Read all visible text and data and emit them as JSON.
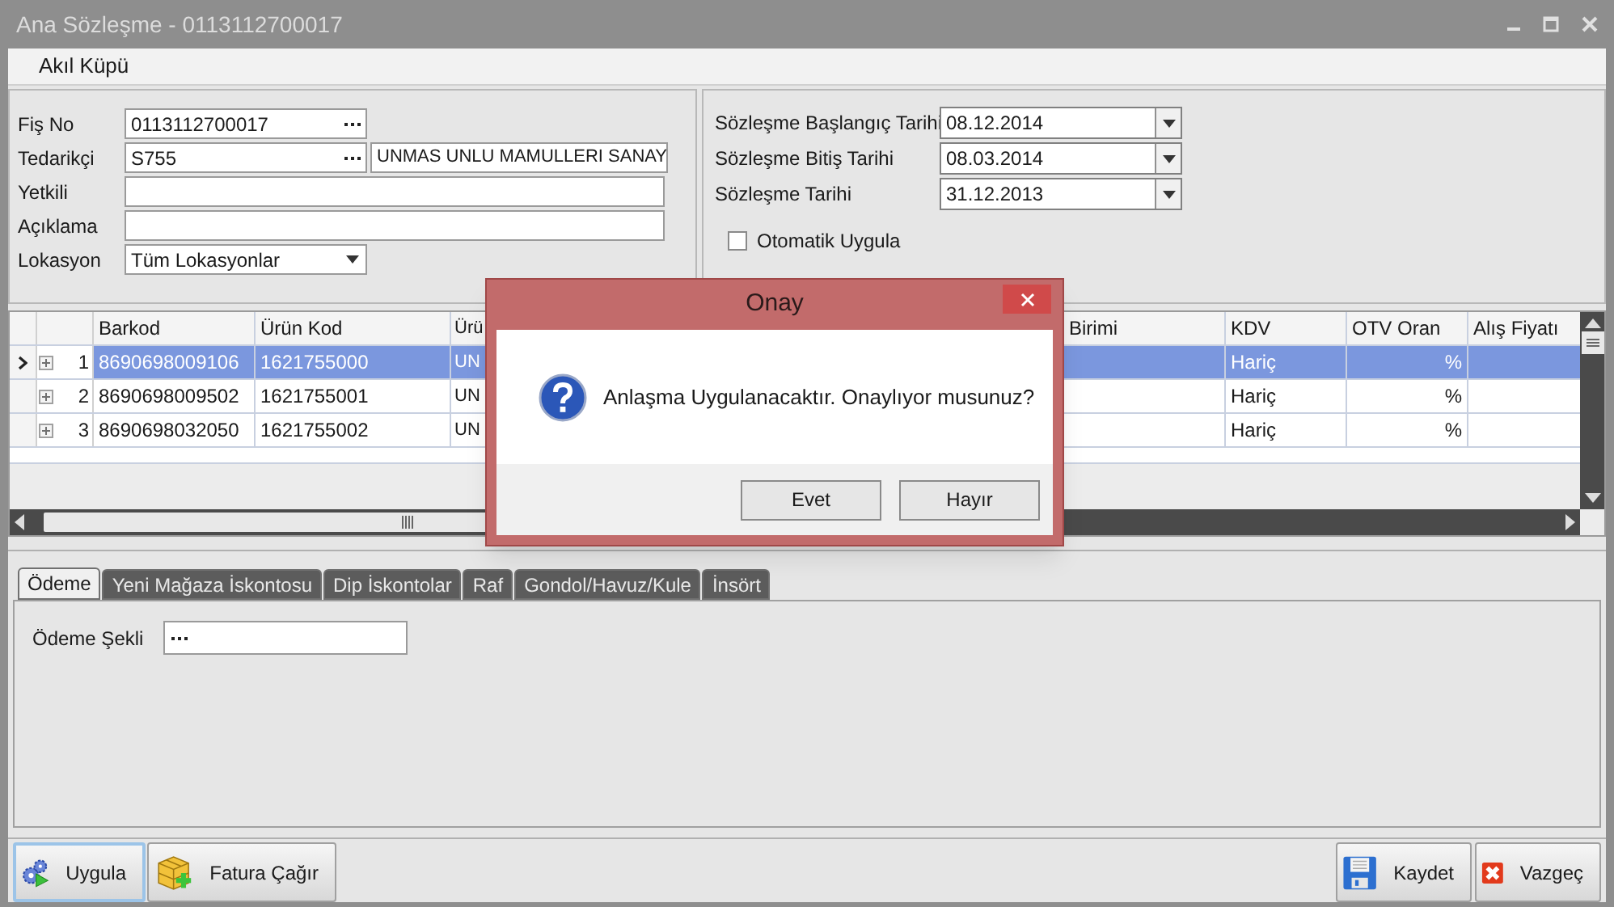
{
  "window": {
    "title": "Ana Sözleşme - 0113112700017"
  },
  "menu": [
    {
      "label": "Akıl Küpü"
    }
  ],
  "header_left": {
    "fields": [
      {
        "kind": "lookup",
        "label": "Fiş No",
        "value": "0113112700017"
      },
      {
        "kind": "lookup_pair",
        "label": "Tedarikçi",
        "value": "S755",
        "value_2": "UNMAS UNLU MAMULLERI SANAY"
      },
      {
        "kind": "text",
        "label": "Yetkili"
      },
      {
        "kind": "text",
        "label": "Açıklama"
      },
      {
        "kind": "dropdown",
        "label": "Lokasyon",
        "value": "Tüm Lokasyonlar"
      }
    ]
  },
  "header_right": {
    "fields": [
      {
        "label": "Sözleşme Başlangıç Tarihi",
        "value": "08.12.2014"
      },
      {
        "label": "Sözleşme Bitiş Tarihi",
        "value": "08.03.2014"
      },
      {
        "label": "Sözleşme Tarihi",
        "value": "31.12.2013"
      }
    ],
    "checkbox": {
      "label": "Otomatik Uygula",
      "checked": false
    }
  },
  "grid": {
    "columns": [
      "Barkod",
      "Ürün Kod",
      "Ürü",
      "Birimi",
      "KDV",
      "OTV Oran",
      "Alış Fiyatı"
    ],
    "rows": [
      {
        "number": "1",
        "selected": true,
        "cells": [
          "8690698009106",
          "1621755000",
          "UN",
          null,
          "Hariç",
          "%",
          null
        ]
      },
      {
        "number": "2",
        "selected": false,
        "cells": [
          "8690698009502",
          "1621755001",
          "UN",
          null,
          "Hariç",
          "%",
          null
        ]
      },
      {
        "number": "3",
        "selected": false,
        "cells": [
          "8690698032050",
          "1621755002",
          "UN",
          null,
          "Hariç",
          "%",
          null
        ]
      }
    ]
  },
  "tabs": [
    {
      "label": "Ödeme",
      "selected": true
    },
    {
      "label": "Yeni Mağaza İskontosu",
      "selected": false
    },
    {
      "label": "Dip İskontolar",
      "selected": false
    },
    {
      "label": "Raf",
      "selected": false
    },
    {
      "label": "Gondol/Havuz/Kule",
      "selected": false
    },
    {
      "label": "İnsört",
      "selected": false
    }
  ],
  "tab_panel": {
    "fields": [
      {
        "label": "Ödeme Şekli"
      }
    ]
  },
  "toolbar_left": [
    {
      "kind": "gears",
      "label": "Uygula",
      "selected": true
    },
    {
      "kind": "cube",
      "label": "Fatura Çağır",
      "selected": false
    }
  ],
  "toolbar_right": [
    {
      "kind": "floppy",
      "label": "Kaydet"
    },
    {
      "kind": "cancel",
      "label": "Vazgeç"
    }
  ],
  "dialog": {
    "title": "Onay",
    "message": "Anlaşma Uygulanacaktır. Onaylıyor musunuz?",
    "buttons": [
      "Evet",
      "Hayır"
    ]
  }
}
